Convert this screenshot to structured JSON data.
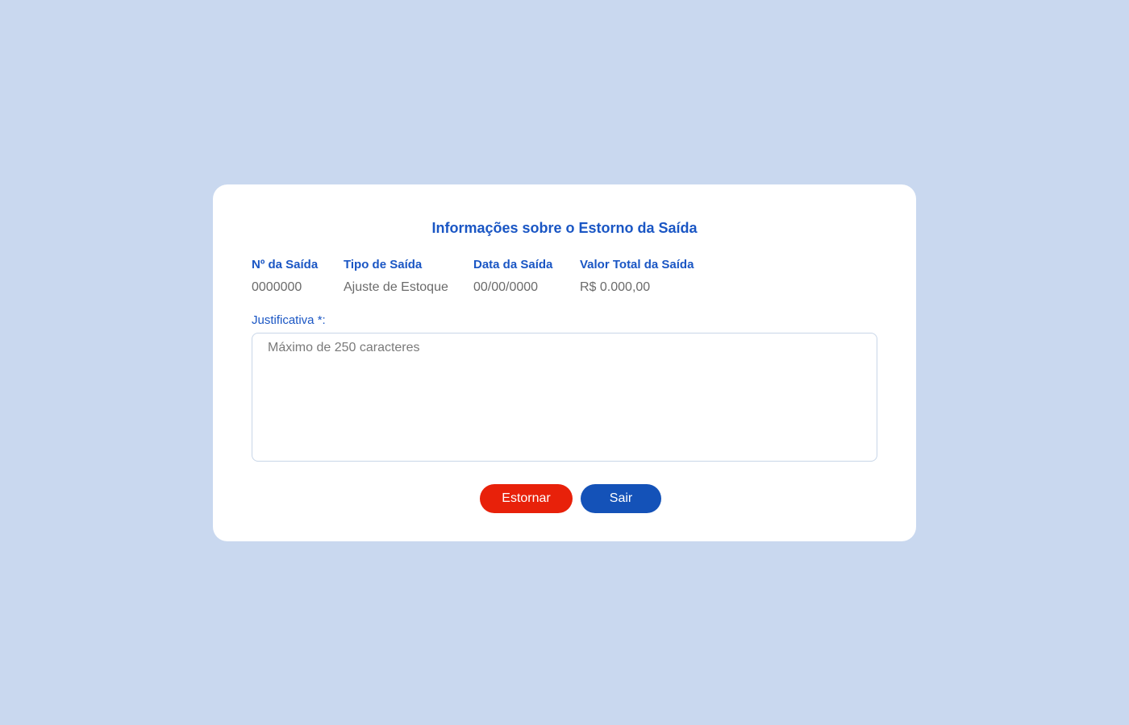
{
  "modal": {
    "title": "Informações sobre o Estorno da Saída",
    "info": [
      {
        "label": "Nº da Saída",
        "value": "0000000"
      },
      {
        "label": "Tipo de Saída",
        "value": "Ajuste de Estoque"
      },
      {
        "label": "Data da Saída",
        "value": "00/00/0000"
      },
      {
        "label": "Valor Total da Saída",
        "value": "R$ 0.000,00"
      }
    ],
    "justificativa": {
      "label": "Justificativa *:",
      "placeholder": "Máximo de 250 caracteres",
      "value": ""
    },
    "buttons": {
      "estornar": "Estornar",
      "sair": "Sair"
    }
  },
  "colors": {
    "background": "#c9d8ef",
    "accent_blue": "#1a56c4",
    "button_red": "#e8210a",
    "button_blue": "#1452b8"
  }
}
